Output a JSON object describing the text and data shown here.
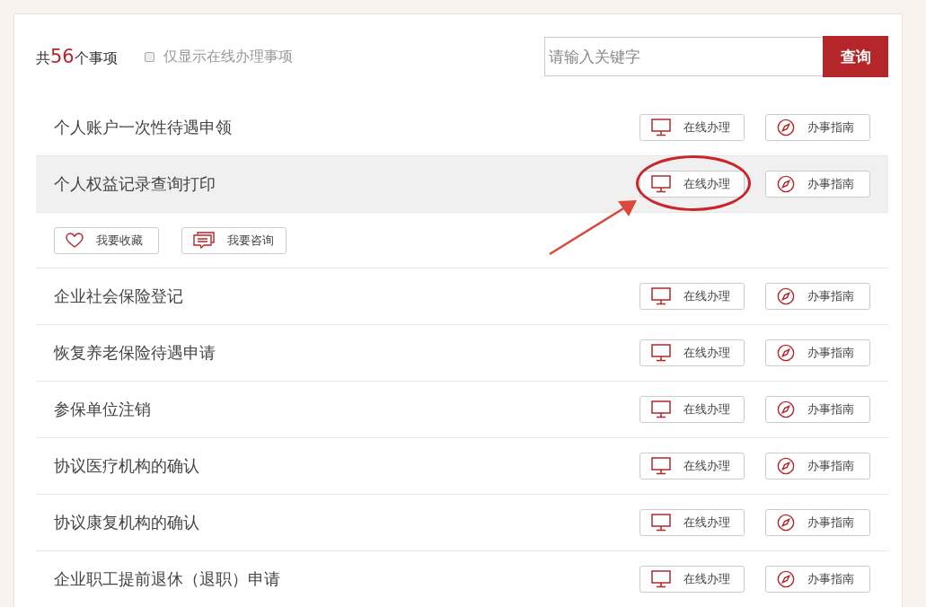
{
  "summary": {
    "prefix": "共",
    "count": "56",
    "suffix": "个事项"
  },
  "filter": {
    "label": "仅显示在线办理事项",
    "checked": false
  },
  "search": {
    "placeholder": "请输入关键字",
    "button": "查询"
  },
  "items": [
    {
      "title": "个人账户一次性待遇申领",
      "online": "在线办理",
      "guide": "办事指南",
      "expanded": false,
      "annotated": false
    },
    {
      "title": "个人权益记录查询打印",
      "online": "在线办理",
      "guide": "办事指南",
      "expanded": true,
      "annotated": true,
      "actions": [
        {
          "kind": "favorite",
          "label": "我要收藏"
        },
        {
          "kind": "consult",
          "label": "我要咨询"
        }
      ]
    },
    {
      "title": "企业社会保险登记",
      "online": "在线办理",
      "guide": "办事指南",
      "expanded": false,
      "annotated": false
    },
    {
      "title": "恢复养老保险待遇申请",
      "online": "在线办理",
      "guide": "办事指南",
      "expanded": false,
      "annotated": false
    },
    {
      "title": "参保单位注销",
      "online": "在线办理",
      "guide": "办事指南",
      "expanded": false,
      "annotated": false
    },
    {
      "title": "协议医疗机构的确认",
      "online": "在线办理",
      "guide": "办事指南",
      "expanded": false,
      "annotated": false
    },
    {
      "title": "协议康复机构的确认",
      "online": "在线办理",
      "guide": "办事指南",
      "expanded": false,
      "annotated": false
    },
    {
      "title": "企业职工提前退休（退职）申请",
      "online": "在线办理",
      "guide": "办事指南",
      "expanded": false,
      "annotated": false
    }
  ]
}
